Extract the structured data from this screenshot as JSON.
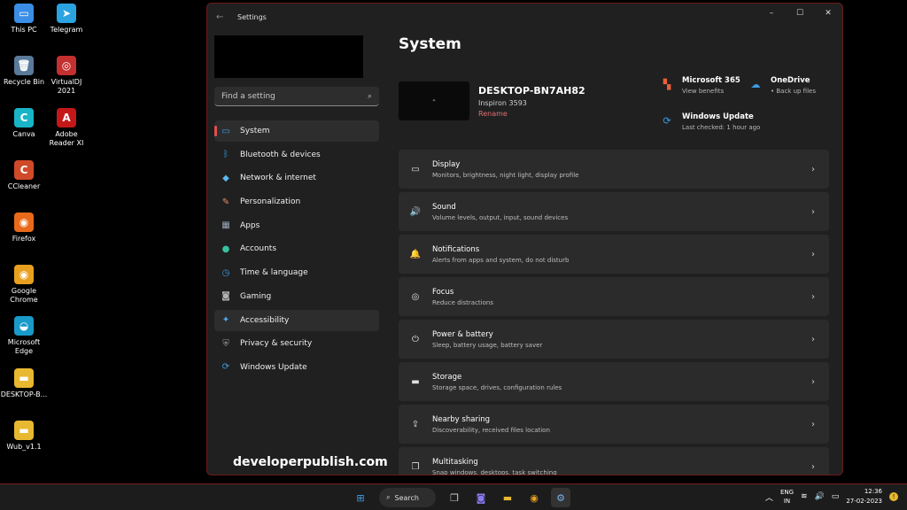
{
  "desktop": {
    "icons": [
      {
        "label": "This PC",
        "glyph": "▭",
        "color": "#3a8ee6"
      },
      {
        "label": "Telegram",
        "glyph": "➤",
        "color": "#2aa3e0"
      },
      {
        "label": "Recycle Bin",
        "glyph": "🗑",
        "color": "#5a7a9a"
      },
      {
        "label": "VirtualDJ 2021",
        "glyph": "◎",
        "color": "#c43030"
      },
      {
        "label": "Canva",
        "glyph": "C",
        "color": "#19b5c7"
      },
      {
        "label": "Adobe Reader XI",
        "glyph": "A",
        "color": "#c41818"
      },
      {
        "label": "CCleaner",
        "glyph": "C",
        "color": "#d04a2a"
      },
      {
        "label": "Firefox",
        "glyph": "◉",
        "color": "#e86a1a"
      },
      {
        "label": "Google Chrome",
        "glyph": "◉",
        "color": "#e8a020"
      },
      {
        "label": "Microsoft Edge",
        "glyph": "◒",
        "color": "#1a9ac8"
      },
      {
        "label": "DESKTOP-B...",
        "glyph": "▬",
        "color": "#e8b830"
      },
      {
        "label": "Wub_v1.1",
        "glyph": "▬",
        "color": "#e8b830"
      }
    ]
  },
  "window": {
    "title": "Settings",
    "back_glyph": "←",
    "controls": {
      "minimize": "–",
      "maximize": "☐",
      "close": "✕"
    }
  },
  "sidebar": {
    "search_placeholder": "Find a setting",
    "items": [
      {
        "label": "System",
        "icon": "▭",
        "color": "#3a9ee8",
        "name": "system"
      },
      {
        "label": "Bluetooth & devices",
        "icon": "ᛒ",
        "color": "#3a9ee8",
        "name": "bluetooth-devices"
      },
      {
        "label": "Network & internet",
        "icon": "◆",
        "color": "#5ab8f0",
        "name": "network-internet"
      },
      {
        "label": "Personalization",
        "icon": "✎",
        "color": "#e89060",
        "name": "personalization"
      },
      {
        "label": "Apps",
        "icon": "▦",
        "color": "#9aa8b8",
        "name": "apps"
      },
      {
        "label": "Accounts",
        "icon": "●",
        "color": "#3ac0a0",
        "name": "accounts"
      },
      {
        "label": "Time & language",
        "icon": "◷",
        "color": "#3a9ee8",
        "name": "time-language"
      },
      {
        "label": "Gaming",
        "icon": "◙",
        "color": "#b0b0b0",
        "name": "gaming"
      },
      {
        "label": "Accessibility",
        "icon": "✦",
        "color": "#4aa8f0",
        "name": "accessibility"
      },
      {
        "label": "Privacy & security",
        "icon": "⛨",
        "color": "#9a9a9a",
        "name": "privacy-security"
      },
      {
        "label": "Windows Update",
        "icon": "⟳",
        "color": "#3a9ee8",
        "name": "windows-update"
      }
    ]
  },
  "main": {
    "title": "System",
    "device": {
      "name": "DESKTOP-BN7AH82",
      "model": "Inspiron 3593",
      "rename": "Rename"
    },
    "quick_links": [
      {
        "title": "Microsoft 365",
        "subtitle": "View benefits",
        "icon": "▚",
        "color": "#e8603a"
      },
      {
        "title": "OneDrive",
        "subtitle": "• Back up files",
        "icon": "☁",
        "color": "#3a9ee8"
      },
      {
        "title": "Windows Update",
        "subtitle": "Last checked: 1 hour ago",
        "icon": "⟳",
        "color": "#3a9ee8"
      }
    ],
    "cards": [
      {
        "title": "Display",
        "subtitle": "Monitors, brightness, night light, display profile",
        "icon": "▭",
        "name": "display"
      },
      {
        "title": "Sound",
        "subtitle": "Volume levels, output, input, sound devices",
        "icon": "🔊",
        "name": "sound"
      },
      {
        "title": "Notifications",
        "subtitle": "Alerts from apps and system, do not disturb",
        "icon": "🔔",
        "name": "notifications"
      },
      {
        "title": "Focus",
        "subtitle": "Reduce distractions",
        "icon": "◎",
        "name": "focus"
      },
      {
        "title": "Power & battery",
        "subtitle": "Sleep, battery usage, battery saver",
        "icon": "⏻",
        "name": "power-battery"
      },
      {
        "title": "Storage",
        "subtitle": "Storage space, drives, configuration rules",
        "icon": "▬",
        "name": "storage"
      },
      {
        "title": "Nearby sharing",
        "subtitle": "Discoverability, received files location",
        "icon": "⇪",
        "name": "nearby-sharing"
      },
      {
        "title": "Multitasking",
        "subtitle": "Snap windows, desktops, task switching",
        "icon": "❐",
        "name": "multitasking"
      }
    ]
  },
  "watermark": "developerpublish.com",
  "taskbar": {
    "search_label": "Search",
    "language": "ENG",
    "region": "IN",
    "time": "12:36",
    "date": "27-02-2023"
  }
}
